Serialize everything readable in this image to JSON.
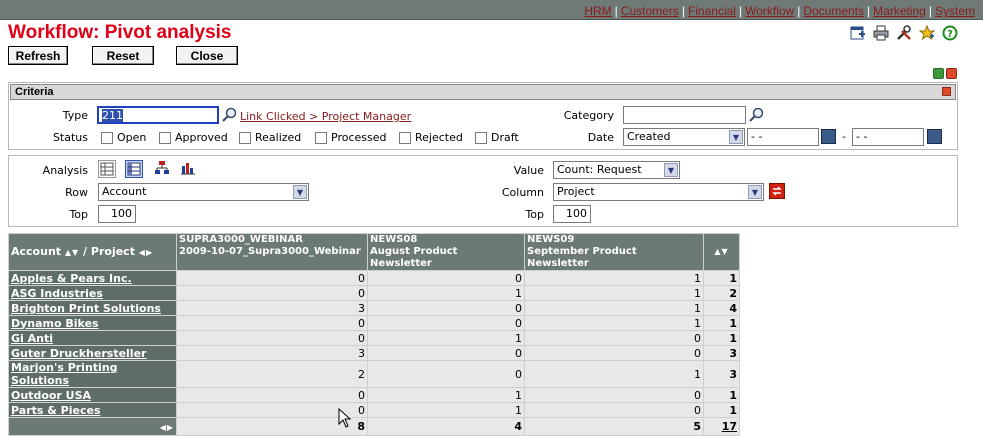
{
  "nav": {
    "items": [
      "HRM",
      "Customers",
      "Financial",
      "Workflow",
      "Documents",
      "Marketing",
      "System"
    ]
  },
  "page_title": "Workflow: Pivot analysis",
  "toolbar": {
    "refresh_label": "Refresh",
    "reset_label": "Reset",
    "close_label": "Close",
    "icons": [
      "new-window-icon",
      "print-icon",
      "tools-icon",
      "favorite-icon",
      "help-icon"
    ]
  },
  "criteria": {
    "header": "Criteria",
    "type_label": "Type",
    "type_value": "211",
    "type_link": "Link Clicked > Project Manager",
    "status_label": "Status",
    "statuses": [
      "Open",
      "Approved",
      "Realized",
      "Processed",
      "Rejected",
      "Draft"
    ],
    "category_label": "Category",
    "category_value": "",
    "date_label": "Date",
    "date_field": "Created",
    "date_from": "- -",
    "date_sep": "-",
    "date_to": "- -"
  },
  "analysis": {
    "analysis_label": "Analysis",
    "row_label": "Row",
    "row_value": "Account",
    "top_label": "Top",
    "top_value": "100",
    "value_label": "Value",
    "value_value": "Count: Request",
    "column_label": "Column",
    "column_value": "Project",
    "top2_label": "Top",
    "top2_value": "100"
  },
  "pivot": {
    "corner_account": "Account",
    "corner_project": "/ Project",
    "columns": [
      {
        "line1": "SUPRA3000_WEBINAR",
        "line2": "2009-10-07_Supra3000_Webinar"
      },
      {
        "line1": "NEWS08",
        "line2": "August Product Newsletter"
      },
      {
        "line1": "NEWS09",
        "line2": "September Product Newsletter"
      }
    ],
    "rows": [
      {
        "account": "Apples & Pears Inc.",
        "values": [
          "0",
          "0",
          "1"
        ],
        "total": "1"
      },
      {
        "account": "ASG Industries",
        "values": [
          "0",
          "1",
          "1"
        ],
        "total": "2"
      },
      {
        "account": "Brighton Print Solutions",
        "values": [
          "3",
          "0",
          "1"
        ],
        "total": "4"
      },
      {
        "account": "Dynamo Bikes",
        "values": [
          "0",
          "0",
          "1"
        ],
        "total": "1"
      },
      {
        "account": "Gi Anti",
        "values": [
          "0",
          "1",
          "0"
        ],
        "total": "1"
      },
      {
        "account": "Guter Druckhersteller",
        "values": [
          "3",
          "0",
          "0"
        ],
        "total": "3"
      },
      {
        "account": "Marjon's Printing Solutions",
        "values": [
          "2",
          "0",
          "1"
        ],
        "total": "3"
      },
      {
        "account": "Outdoor USA",
        "values": [
          "0",
          "1",
          "0"
        ],
        "total": "1"
      },
      {
        "account": "Parts & Pieces",
        "values": [
          "0",
          "1",
          "0"
        ],
        "total": "1"
      }
    ],
    "totals": [
      "8",
      "4",
      "5"
    ],
    "grand_total": "17"
  }
}
